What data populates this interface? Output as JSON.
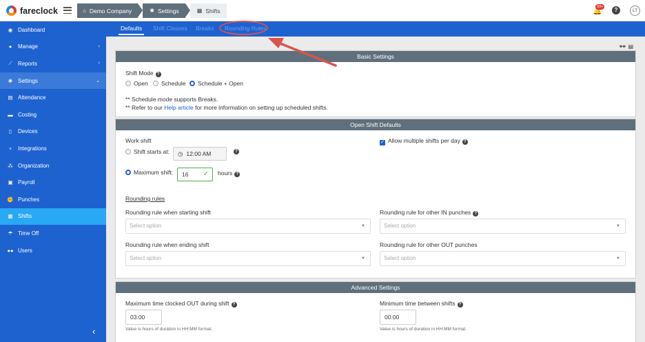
{
  "app": {
    "name": "fareclock"
  },
  "breadcrumbs": [
    {
      "label": "Demo Company",
      "icon": "home-icon"
    },
    {
      "label": "Settings",
      "icon": "gear-icon"
    },
    {
      "label": "Shifts",
      "icon": "calendar-icon"
    }
  ],
  "header": {
    "notification_count": "33+",
    "avatar_initials": "LT",
    "help": "?"
  },
  "sidebar": {
    "items": [
      {
        "label": "Dashboard",
        "icon": "dashboard-icon"
      },
      {
        "label": "Manage",
        "icon": "user-icon",
        "chevron": "‹"
      },
      {
        "label": "Reports",
        "icon": "chart-icon",
        "chevron": "‹"
      },
      {
        "label": "Settings",
        "icon": "gear-icon",
        "chevron": "⌄"
      },
      {
        "label": "Attendance",
        "icon": "attendance-icon"
      },
      {
        "label": "Costing",
        "icon": "costing-icon"
      },
      {
        "label": "Devices",
        "icon": "device-icon"
      },
      {
        "label": "Integrations",
        "icon": "plug-icon"
      },
      {
        "label": "Organization",
        "icon": "org-icon"
      },
      {
        "label": "Payroll",
        "icon": "payroll-icon"
      },
      {
        "label": "Punches",
        "icon": "punch-icon"
      },
      {
        "label": "Shifts",
        "icon": "calendar-icon"
      },
      {
        "label": "Time Off",
        "icon": "beach-icon"
      },
      {
        "label": "Users",
        "icon": "users-icon"
      }
    ],
    "collapse": "‹"
  },
  "tabs": [
    "Defaults",
    "Shift Classes",
    "Breaks",
    "Rounding Rules"
  ],
  "basic": {
    "title": "Basic Settings",
    "shift_mode_label": "Shift Mode",
    "options": [
      "Open",
      "Schedule",
      "Schedule + Open"
    ],
    "selected": "Schedule + Open",
    "note1": "** Schedule mode supports Breaks.",
    "note2_prefix": "** Refer to our",
    "note2_link": "Help article",
    "note2_suffix": "for more information on setting up scheduled shifts."
  },
  "open_shift": {
    "title": "Open Shift Defaults",
    "work_shift_label": "Work shift",
    "shift_starts_label": "Shift starts at:",
    "shift_starts_value": "12:00 AM",
    "max_shift_label": "Maximum shift:",
    "max_shift_value": "16",
    "hours_label": "hours",
    "allow_multiple_label": "Allow multiple shifts per day",
    "rounding_title": "Rounding rules",
    "rr_start_label": "Rounding rule when starting shift",
    "rr_end_label": "Rounding rule when ending shift",
    "rr_in_label": "Rounding rule for other IN punches",
    "rr_out_label": "Rounding rule for other OUT punches",
    "placeholder": "Select option"
  },
  "advanced": {
    "title": "Advanced Settings",
    "max_out_label": "Maximum time clocked OUT during shift",
    "max_out_value": "03:00",
    "max_out_hint": "Value is hours of duration in HH:MM format.",
    "min_between_label": "Minimum time between shifts",
    "min_between_value": "00:00",
    "min_between_hint": "Value is hours of duration in HH:MM format."
  },
  "colors": {
    "sidebar": "#1e62d0",
    "active": "#29a8f3",
    "panel_header": "#5f6f7c",
    "annotation": "#d9534f"
  }
}
